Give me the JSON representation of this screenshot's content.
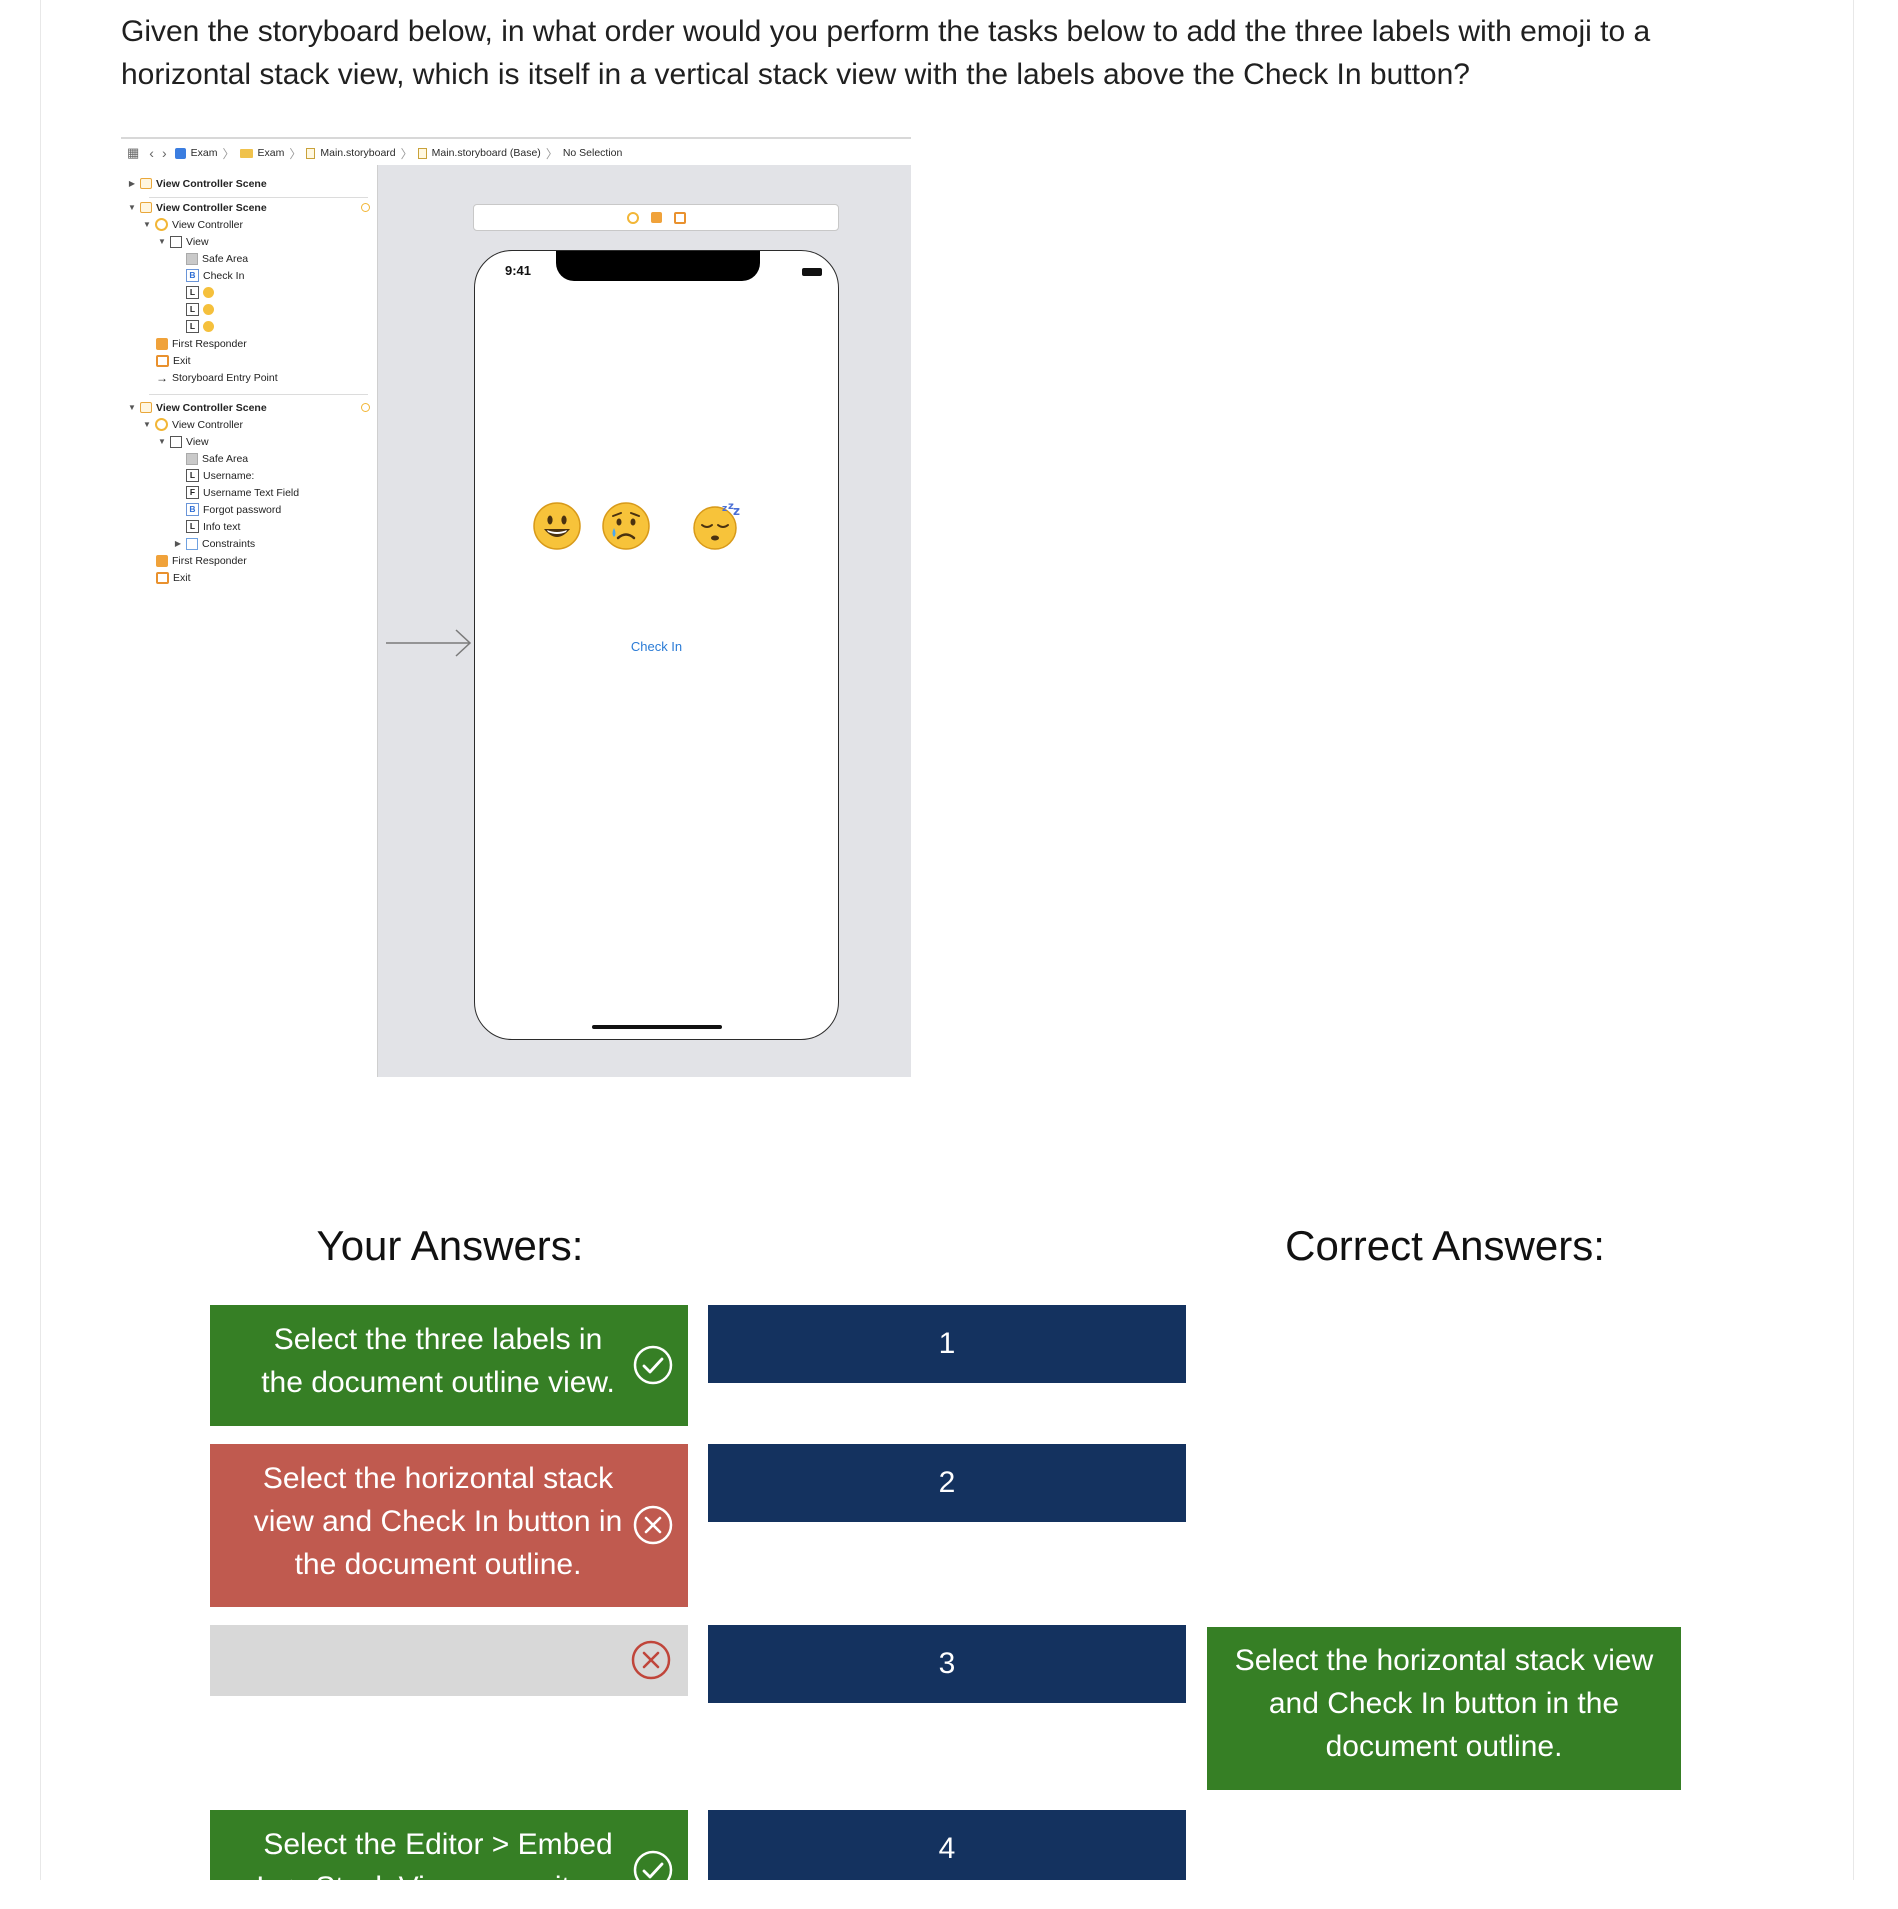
{
  "question": "Given the storyboard below, in what order would you perform the tasks below to add the three labels with emoji to a horizontal stack view, which is itself in a vertical stack view with the labels above the Check In button?",
  "xcode": {
    "breadcrumb": [
      "Exam",
      "Exam",
      "Main.storyboard",
      "Main.storyboard (Base)",
      "No Selection"
    ],
    "outline": {
      "scene_1": "View Controller Scene",
      "scene_2": "View Controller Scene",
      "vc_2": "View Controller",
      "view_2": "View",
      "safe_area_2": "Safe Area",
      "check_in": "Check In",
      "first_responder_2": "First Responder",
      "exit_2": "Exit",
      "entry_point": "Storyboard Entry Point",
      "scene_3": "View Controller Scene",
      "vc_3": "View Controller",
      "view_3": "View",
      "safe_area_3": "Safe Area",
      "username": "Username:",
      "username_field": "Username Text Field",
      "forgot_password": "Forgot password",
      "info_text": "Info text",
      "constraints": "Constraints",
      "first_responder_3": "First Responder",
      "exit_3": "Exit",
      "type_L": "L",
      "type_B": "B",
      "type_F": "F"
    },
    "phone": {
      "time": "9:41",
      "button": "Check In"
    }
  },
  "your_answers_title": "Your Answers:",
  "correct_answers_title": "Correct Answers:",
  "your_answers": [
    {
      "text": "Select the three labels in the document outline view.",
      "status": "correct"
    },
    {
      "text": "Select the horizontal stack view and Check In button in the document outline.",
      "status": "incorrect"
    },
    {
      "text": "",
      "status": "incorrect"
    },
    {
      "text": "Select the Editor > Embed In > Stack View menu item.",
      "status": "correct"
    }
  ],
  "slots": [
    "1",
    "2",
    "3",
    "4"
  ],
  "correct_answers": [
    {
      "slot": "3",
      "text": "Select the horizontal stack view and Check In button in the document outline."
    }
  ],
  "colors": {
    "correct": "#367f25",
    "incorrect": "#c05a4f",
    "slot": "#14325f",
    "empty": "#d8d8d8",
    "link_blue": "#2a7bd6"
  }
}
